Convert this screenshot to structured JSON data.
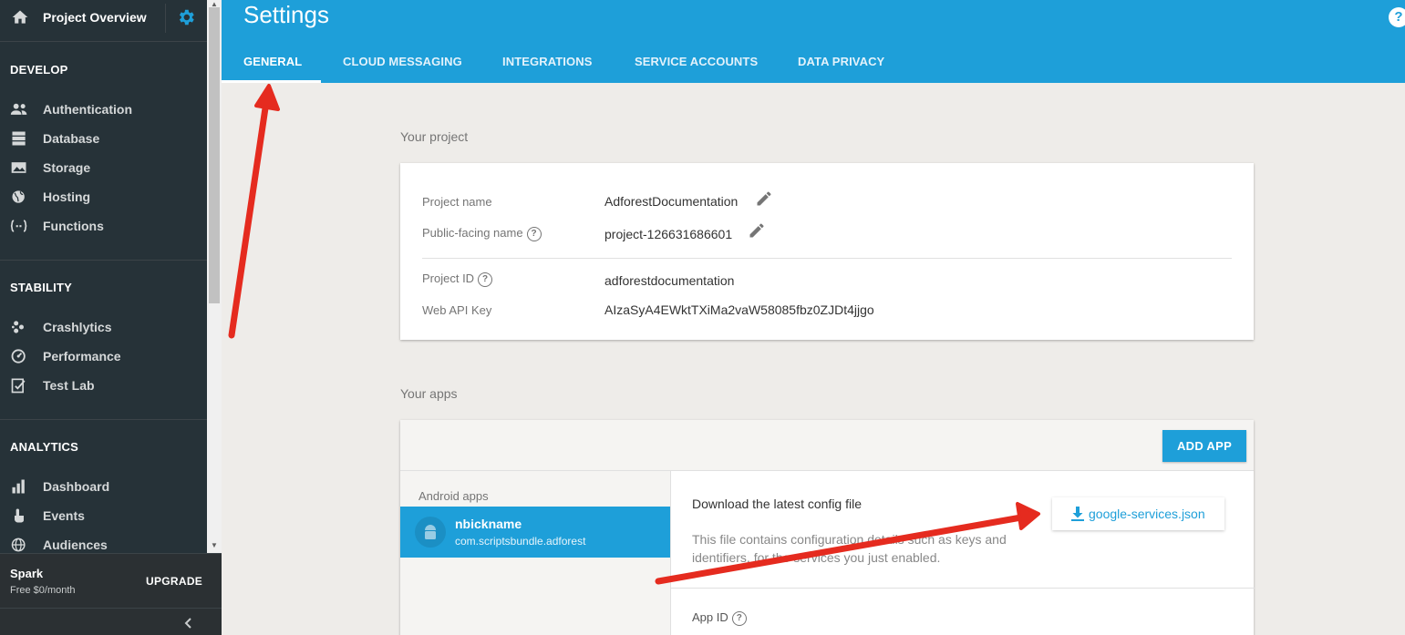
{
  "sidebar": {
    "project_title": "Project Overview",
    "sections": [
      {
        "heading": "DEVELOP",
        "items": [
          {
            "label": "Authentication",
            "icon": "people-icon"
          },
          {
            "label": "Database",
            "icon": "database-icon"
          },
          {
            "label": "Storage",
            "icon": "image-icon"
          },
          {
            "label": "Hosting",
            "icon": "globe-icon"
          },
          {
            "label": "Functions",
            "icon": "functions-icon"
          }
        ]
      },
      {
        "heading": "STABILITY",
        "items": [
          {
            "label": "Crashlytics",
            "icon": "crashlytics-icon"
          },
          {
            "label": "Performance",
            "icon": "speedometer-icon"
          },
          {
            "label": "Test Lab",
            "icon": "checklist-icon"
          }
        ]
      },
      {
        "heading": "ANALYTICS",
        "items": [
          {
            "label": "Dashboard",
            "icon": "bar-chart-icon"
          },
          {
            "label": "Events",
            "icon": "touch-icon"
          },
          {
            "label": "Audiences",
            "icon": "globe-icon"
          }
        ]
      }
    ],
    "plan": {
      "name": "Spark",
      "price": "Free $0/month",
      "upgrade_label": "UPGRADE"
    }
  },
  "header": {
    "title": "Settings",
    "tabs": [
      {
        "label": "GENERAL",
        "active": true
      },
      {
        "label": "CLOUD MESSAGING",
        "active": false
      },
      {
        "label": "INTEGRATIONS",
        "active": false
      },
      {
        "label": "SERVICE ACCOUNTS",
        "active": false
      },
      {
        "label": "DATA PRIVACY",
        "active": false
      }
    ],
    "help_glyph": "?"
  },
  "project": {
    "section_label": "Your project",
    "fields": {
      "project_name": {
        "key": "Project name",
        "value": "AdforestDocumentation"
      },
      "public_name": {
        "key": "Public-facing name",
        "value": "project-126631686601"
      },
      "project_id": {
        "key": "Project ID",
        "value": "adforestdocumentation"
      },
      "web_api_key": {
        "key": "Web API Key",
        "value": "AIzaSyA4EWktTXiMa2vaW58085fbz0ZJDt4jjgo"
      }
    }
  },
  "apps": {
    "section_label": "Your apps",
    "add_app_label": "ADD APP",
    "group_label": "Android apps",
    "selected_app": {
      "nickname": "nbickname",
      "package": "com.scriptsbundle.adforest"
    },
    "download_title": "Download the latest config file",
    "download_desc": "This file contains configuration details such as keys and identifiers, for the services you just enabled.",
    "download_button_label": "google-services.json",
    "app_id_label": "App ID"
  },
  "colors": {
    "brand_blue": "#1e9fd9",
    "sidebar_bg": "#263238",
    "annotation_arrow": "#e52b1f"
  }
}
